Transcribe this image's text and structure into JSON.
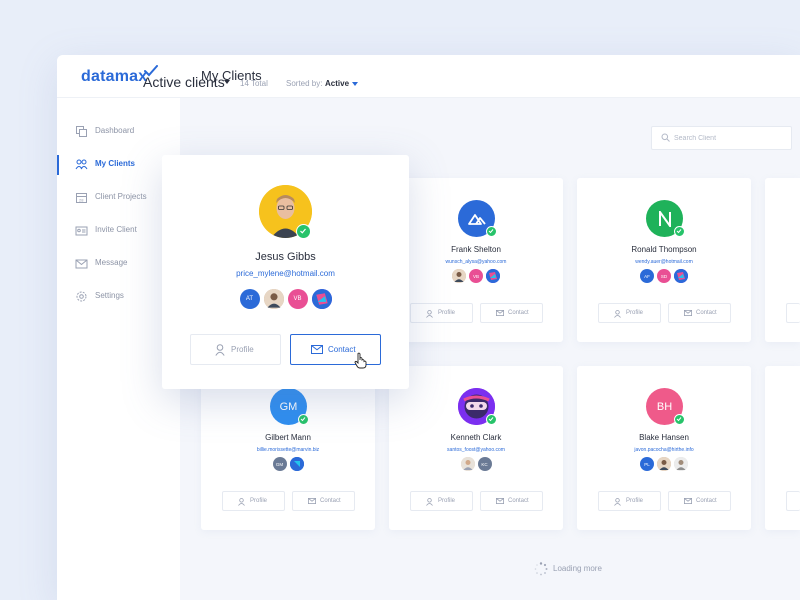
{
  "app": {
    "logo": "datamax",
    "page_title": "My Clients"
  },
  "sidebar": {
    "items": [
      {
        "label": "Dashboard",
        "icon": "dashboard-icon",
        "active": false
      },
      {
        "label": "My Clients",
        "icon": "clients-icon",
        "active": true
      },
      {
        "label": "Client Projects",
        "icon": "calendar-icon",
        "active": false
      },
      {
        "label": "Invite Client",
        "icon": "invite-icon",
        "active": false
      },
      {
        "label": "Message",
        "icon": "message-icon",
        "active": false
      },
      {
        "label": "Settings",
        "icon": "settings-icon",
        "active": false
      }
    ]
  },
  "main": {
    "heading": "Active clients",
    "total": "14 Total",
    "sorted_label": "Sorted by:",
    "sorted_value": "Active",
    "search_placeholder": "Search Client",
    "loading": "Loading more"
  },
  "buttons": {
    "profile": "Profile",
    "contact": "Contact"
  },
  "popover": {
    "name": "Jesus Gibbs",
    "email": "price_mylene@hotmail.com",
    "collaborators": [
      "AT",
      "",
      "VB",
      ""
    ]
  },
  "clients": [
    {
      "name": "Frank Shelton",
      "email": "wunsch_alysa@yahoo.com",
      "initials": "",
      "collaborators": [
        "",
        "VB",
        ""
      ]
    },
    {
      "name": "Ronald Thompson",
      "email": "wendy.auer@hotmail.com",
      "initials": "N",
      "collaborators": [
        "AF",
        "SD",
        ""
      ]
    },
    {
      "name": "Gilbert Mann",
      "email": "billie.morissette@marvin.biz",
      "initials": "GM",
      "collaborators": [
        "GM",
        ""
      ]
    },
    {
      "name": "Kenneth Clark",
      "email": "santos_foost@yahoo.com",
      "initials": "",
      "collaborators": [
        "",
        "KC"
      ]
    },
    {
      "name": "Blake Hansen",
      "email": "javon.pacocha@hirthe.info",
      "initials": "BH",
      "collaborators": [
        "PL",
        "",
        ""
      ]
    }
  ],
  "colors": {
    "accent": "#2b6ad8",
    "online": "#27c36a",
    "background": "#e8eef9"
  }
}
